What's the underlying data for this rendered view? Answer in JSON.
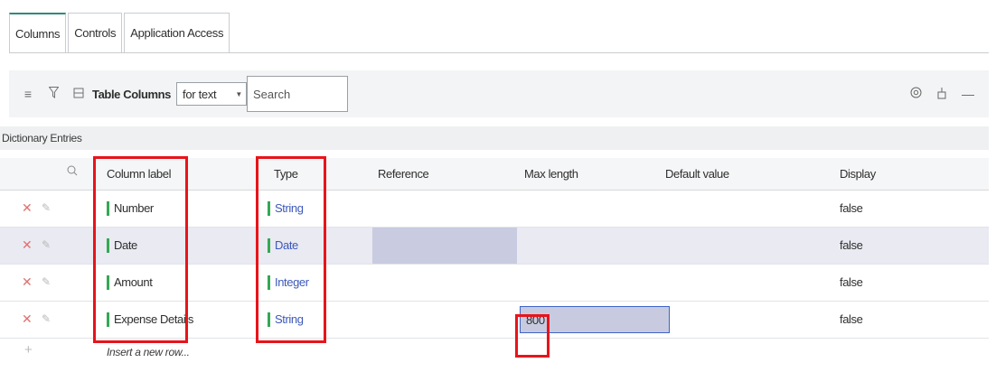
{
  "tabs": [
    {
      "label": "Columns",
      "active": true
    },
    {
      "label": "Controls",
      "active": false
    },
    {
      "label": "Application Access",
      "active": false
    }
  ],
  "toolbar": {
    "title": "Table Columns",
    "filter_select_value": "for text",
    "search_placeholder": "Search",
    "icons": [
      "menu-icon",
      "filter-icon",
      "list-icon",
      "settings-icon",
      "personalize-icon",
      "collapse-icon"
    ]
  },
  "section": {
    "label": "Dictionary Entries"
  },
  "table": {
    "headers": {
      "column_label": "Column label",
      "type": "Type",
      "reference": "Reference",
      "max_length": "Max length",
      "default_value": "Default value",
      "display": "Display"
    },
    "rows": [
      {
        "column_label": "Number",
        "type": "String",
        "reference": "",
        "max_length": "",
        "default_value": "",
        "display": "false"
      },
      {
        "column_label": "Date",
        "type": "Date",
        "reference": "",
        "max_length": "",
        "default_value": "",
        "display": "false"
      },
      {
        "column_label": "Amount",
        "type": "Integer",
        "reference": "",
        "max_length": "",
        "default_value": "",
        "display": "false"
      },
      {
        "column_label": "Expense Details",
        "type": "String",
        "reference": "",
        "max_length": "800",
        "default_value": "",
        "display": "false"
      }
    ],
    "insert_row_label": "Insert a new row..."
  },
  "colors": {
    "accent_tab": "#2f8a7a",
    "type_bar": "#35a853",
    "delete_icon": "#e07070",
    "highlight_box": "#e8141a",
    "selected_cell": "#c8cbe0",
    "input_border": "#3d63c7"
  }
}
